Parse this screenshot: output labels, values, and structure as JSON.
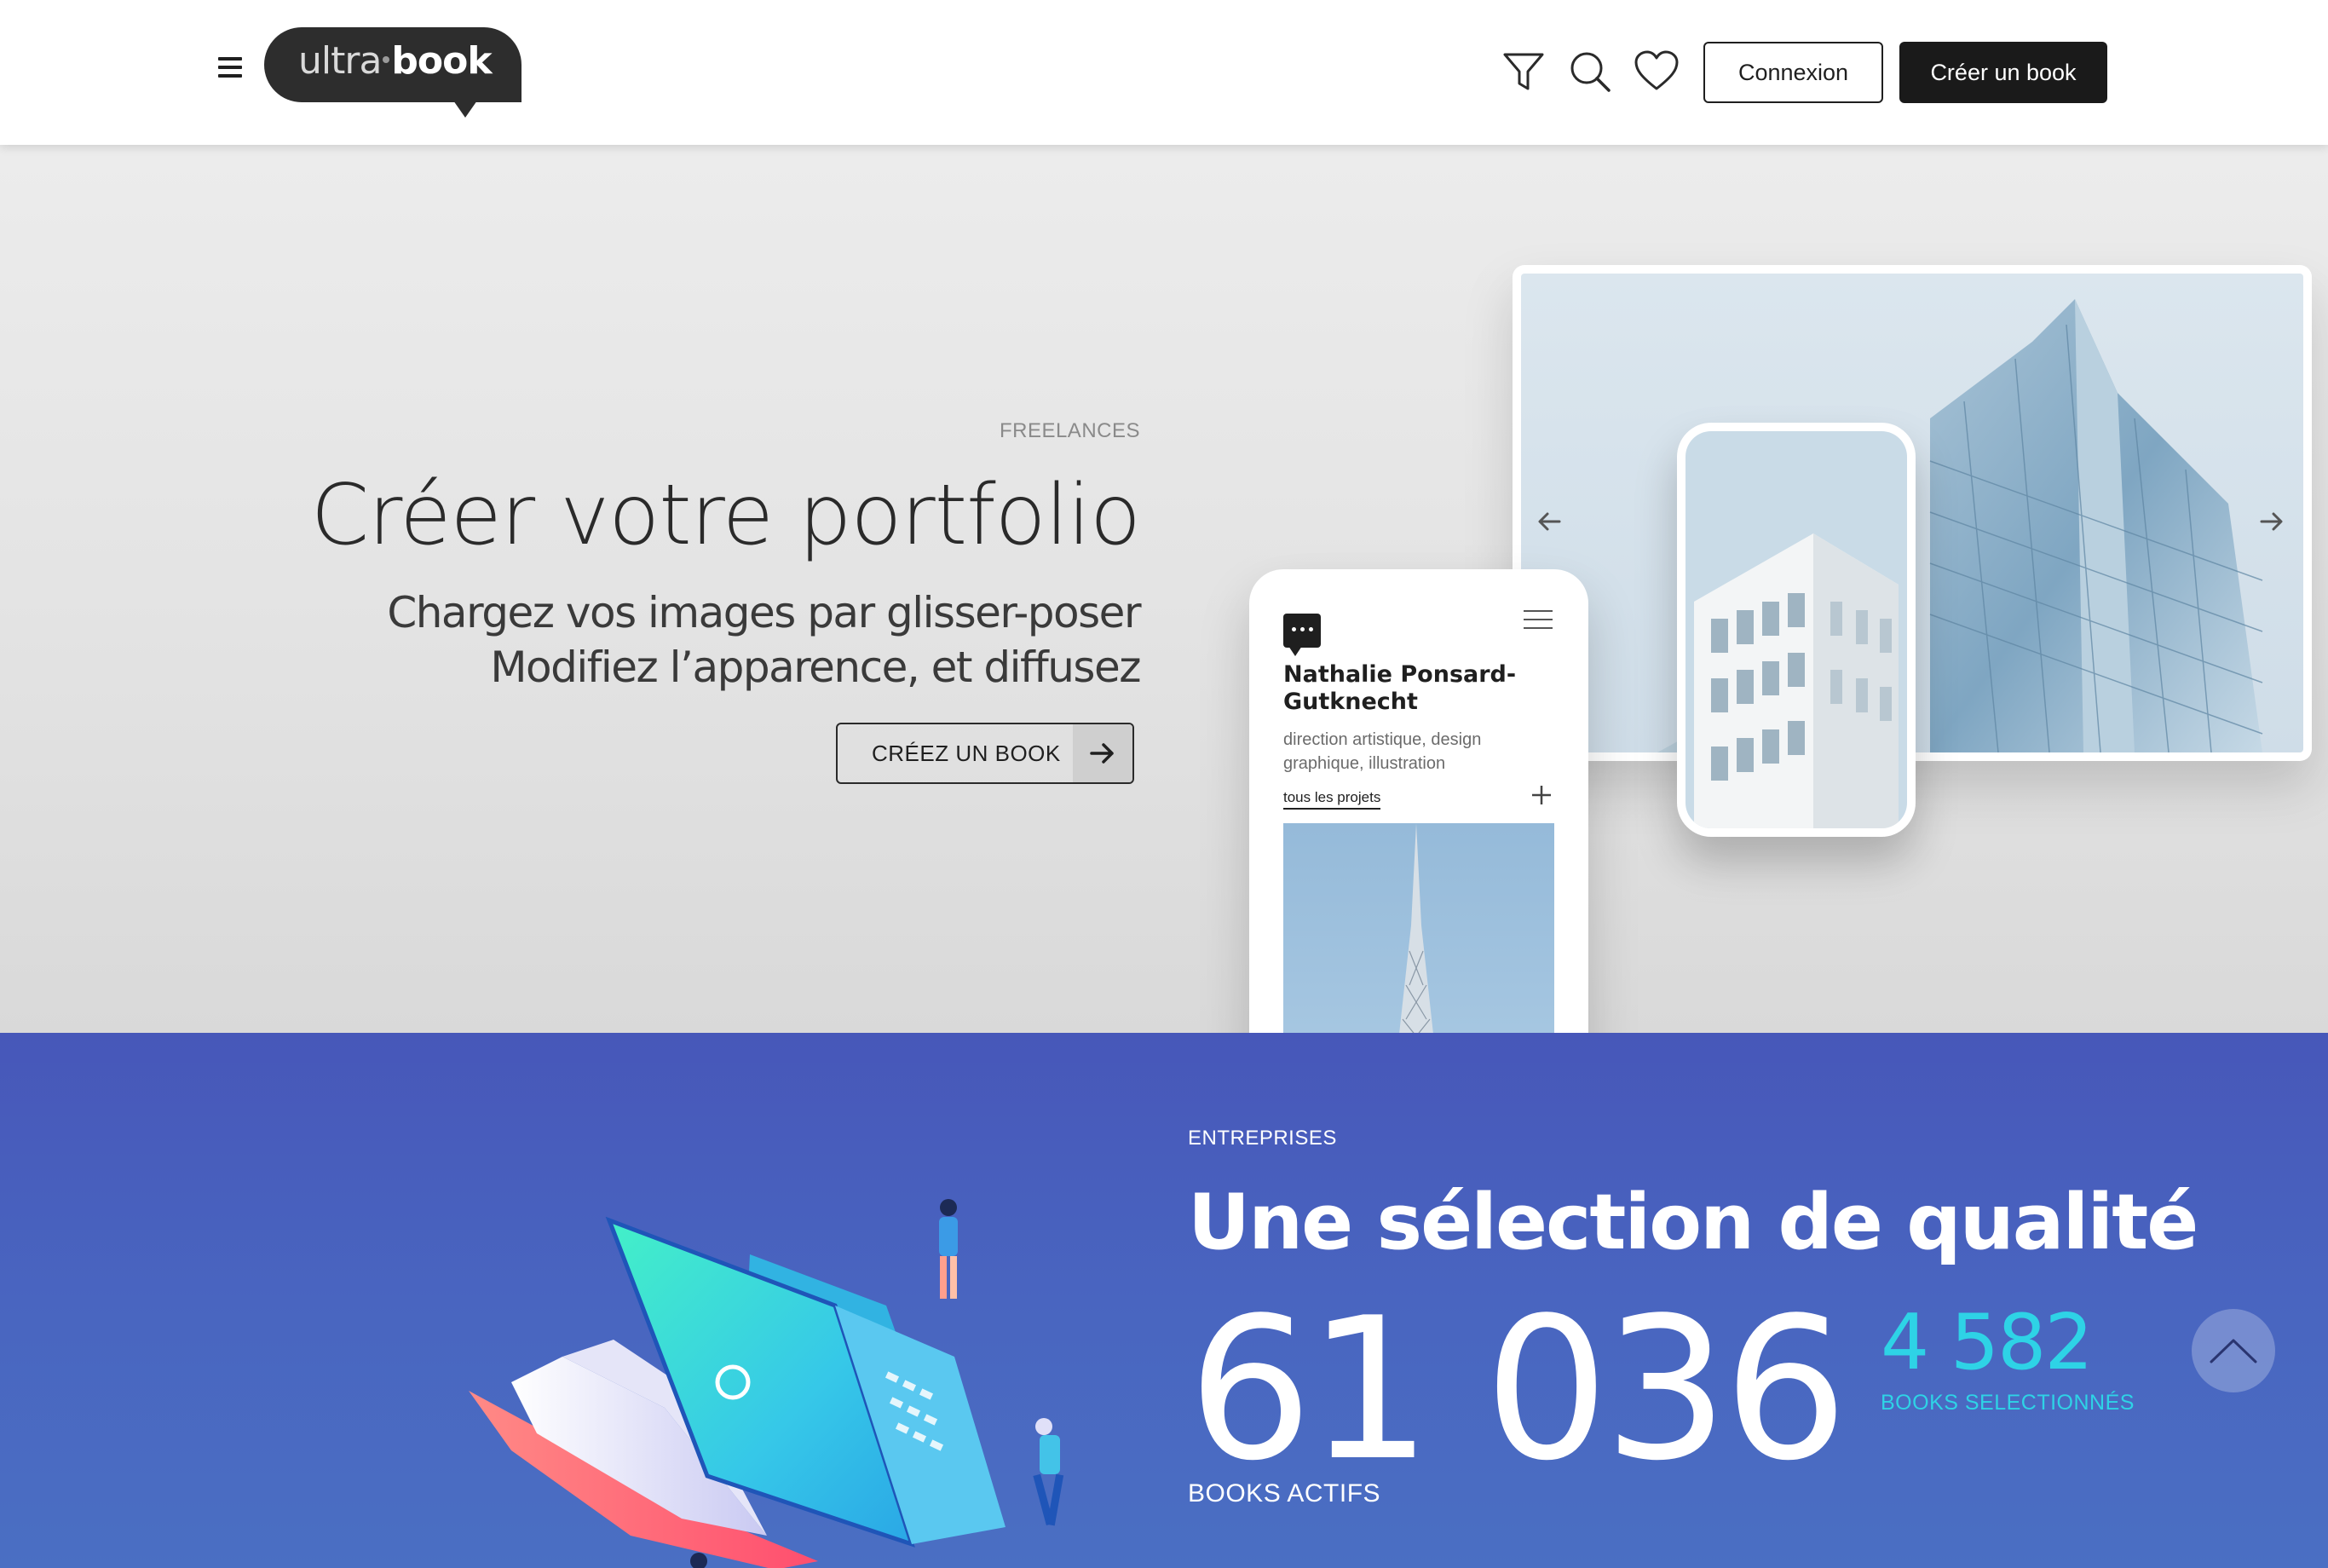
{
  "header": {
    "logo": {
      "part1": "ultra",
      "part2": "book"
    },
    "icons": [
      "menu-icon",
      "filter-icon",
      "search-icon",
      "heart-icon"
    ],
    "login_label": "Connexion",
    "create_label": "Créer un book"
  },
  "hero": {
    "eyebrow": "FREELANCES",
    "title": "Créer votre portfolio",
    "subtitle_line1": "Chargez vos images par glisser-poser",
    "subtitle_line2": "Modifiez l’apparence, et diffusez",
    "cta_label": "CRÉEZ UN BOOK",
    "phone": {
      "name": "Nathalie Ponsard-Gutknecht",
      "description": "direction artistique,  design graphique, illustration",
      "link": "tous les projets"
    }
  },
  "enterprises": {
    "eyebrow": "ENTREPRISES",
    "title": "Une sélection de qualité",
    "active_count": "61 036",
    "active_label": "BOOKS ACTIFS",
    "selected_count": "4 582",
    "selected_label": "BOOKS SELECTIONNÉS"
  },
  "colors": {
    "blue_bg": "#4a62bf",
    "accent_cyan": "#2ed3e6",
    "dark_button": "#1a1a1a"
  }
}
